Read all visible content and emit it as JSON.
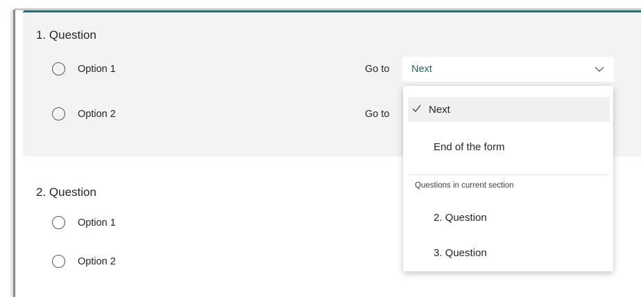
{
  "questions": [
    {
      "title": "1. Question",
      "options": [
        {
          "label": "Option 1",
          "goto_label": "Go to"
        },
        {
          "label": "Option 2",
          "goto_label": "Go to"
        }
      ]
    },
    {
      "title": "2. Question",
      "options": [
        {
          "label": "Option 1"
        },
        {
          "label": "Option 2"
        }
      ]
    }
  ],
  "branch_select": {
    "value": "Next",
    "icon": "chevron-down-icon"
  },
  "dropdown": {
    "items": [
      {
        "label": "Next",
        "selected": true,
        "icon": "checkmark-icon"
      },
      {
        "label": "End of the form",
        "selected": false
      }
    ],
    "group_header": "Questions in current section",
    "group_items": [
      {
        "label": "2. Question"
      },
      {
        "label": "3. Question"
      }
    ]
  },
  "colors": {
    "accent": "#2b6f72",
    "card_background": "#f3f3f3",
    "selected_item_background": "#f0f0f0"
  }
}
